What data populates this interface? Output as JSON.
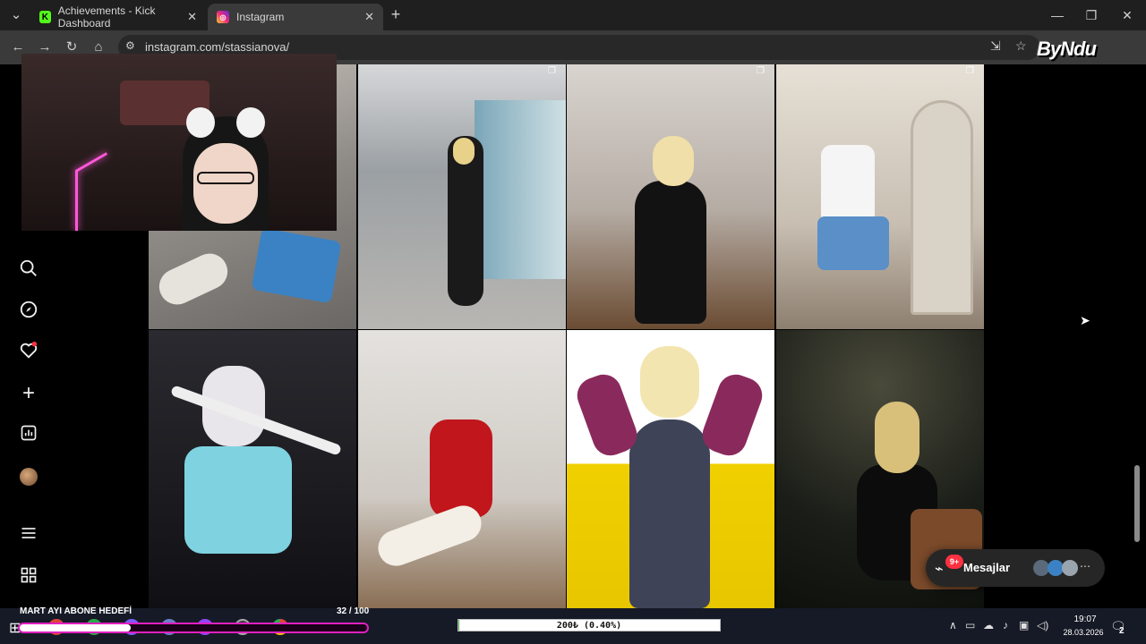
{
  "browser": {
    "tabs": [
      {
        "title": "Achievements - Kick Dashboard",
        "favicon": "K"
      },
      {
        "title": "Instagram",
        "favicon": "ig"
      }
    ],
    "url": "instagram.com/stassianova/",
    "brand_logo_text": "ByNdu",
    "icons": [
      "tab-list-icon",
      "back-icon",
      "forward-icon",
      "reload-icon",
      "home-icon",
      "site-info-icon",
      "install-app-icon",
      "bookmark-star-icon",
      "minimize-icon",
      "maximize-icon",
      "close-icon"
    ]
  },
  "instagram": {
    "sidebar_icons": [
      "home-icon",
      "search-icon",
      "explore-icon",
      "notifications-heart-icon",
      "create-plus-icon",
      "dashboard-icon",
      "profile-avatar-icon",
      "more-menu-icon",
      "apps-icon"
    ],
    "notification_dot_color": "#ff3040",
    "messages": {
      "label": "Mesajlar",
      "badge": "9+"
    }
  },
  "overlay": {
    "goal_label": "MART AYI ABONE HEDEFİ",
    "goal_count": "32 / 100",
    "goal_progress": 0.32,
    "goal_color": "#e020c0",
    "donation_text": "200₺ (0.40%)",
    "donation_progress": 0.004
  },
  "taskbar": {
    "time": "19:07",
    "date": "28.03.2026",
    "notifications": "2"
  }
}
